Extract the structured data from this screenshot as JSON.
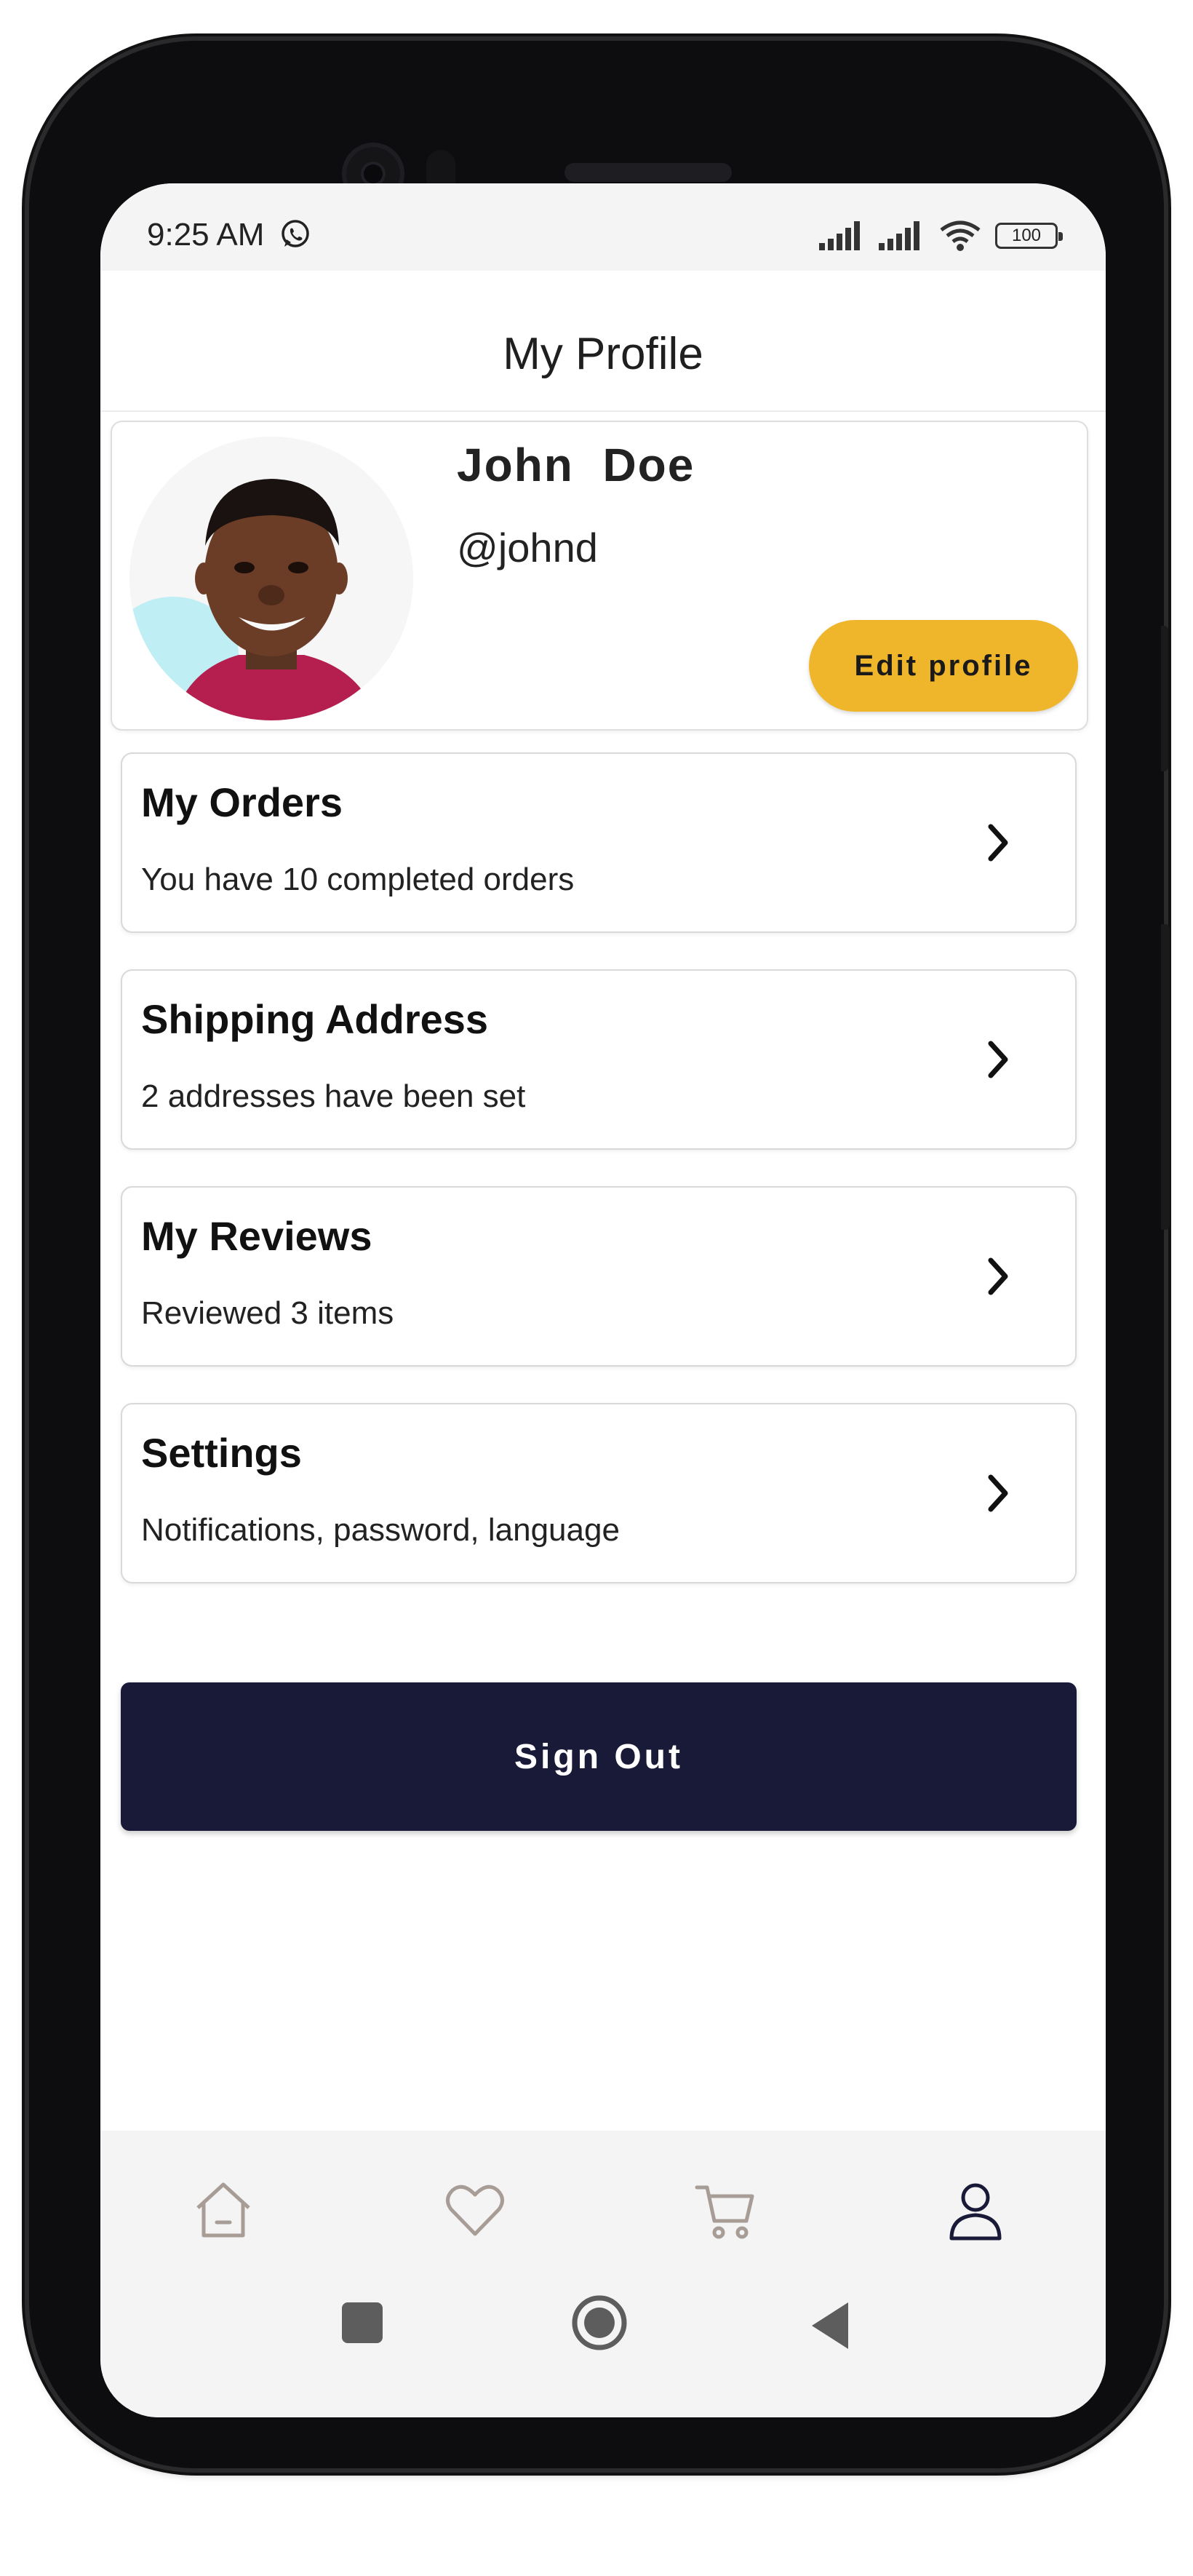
{
  "status_bar": {
    "time": "9:25 AM",
    "battery": "100",
    "icons": [
      "whatsapp-icon",
      "signal-icon",
      "signal-icon",
      "wifi-icon",
      "battery-icon"
    ]
  },
  "header": {
    "title": "My Profile"
  },
  "profile": {
    "name": "John  Doe",
    "handle": "@johnd",
    "edit_label": "Edit profile",
    "accent_color": "#f0b62b"
  },
  "menu": [
    {
      "title": "My Orders",
      "subtitle": "You have 10 completed orders"
    },
    {
      "title": "Shipping Address",
      "subtitle": "2 addresses have been set"
    },
    {
      "title": "My Reviews",
      "subtitle": "Reviewed 3 items"
    },
    {
      "title": "Settings",
      "subtitle": "Notifications, password, language"
    }
  ],
  "signout": {
    "label": "Sign Out",
    "color": "#181a38"
  },
  "bottom_nav": {
    "items": [
      "home-icon",
      "heart-icon",
      "cart-icon",
      "user-icon"
    ],
    "active": "user-icon"
  },
  "system_nav": [
    "recents-icon",
    "home-button-icon",
    "back-icon"
  ]
}
